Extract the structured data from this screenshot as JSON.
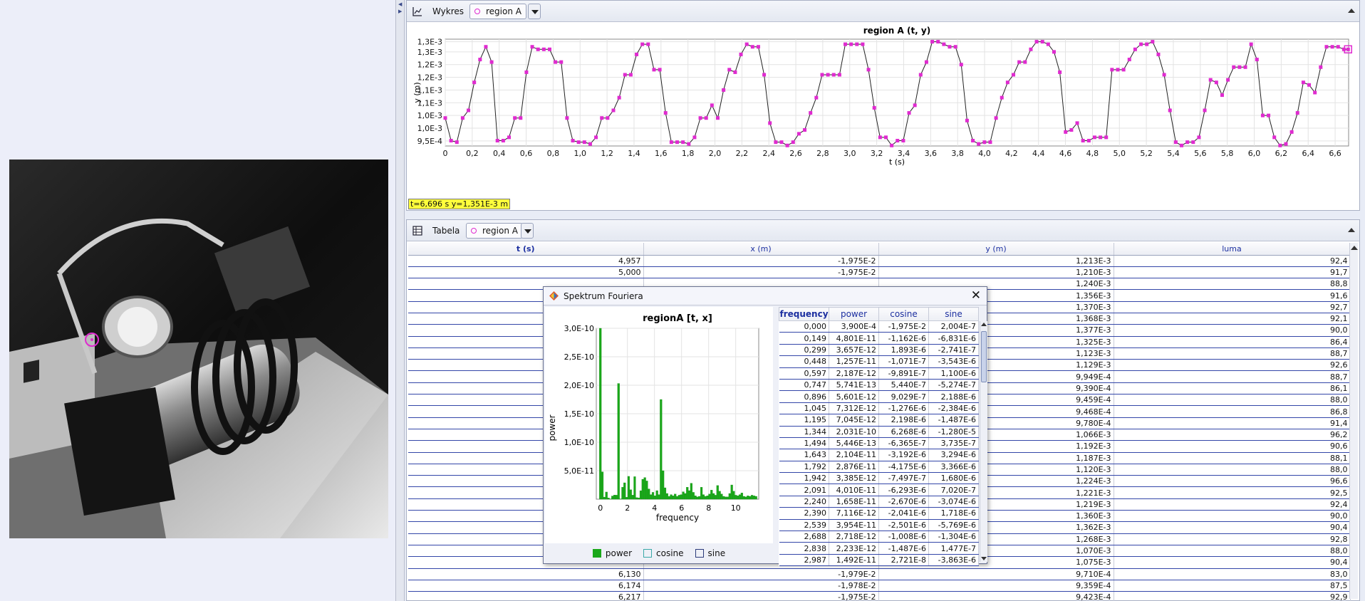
{
  "plot_panel": {
    "title": "Wykres",
    "track": "region A"
  },
  "table_panel": {
    "title": "Tabela",
    "track": "region A"
  },
  "readout": "t=6,696 s  y=1,351E-3 m",
  "chart_data": [
    {
      "type": "line",
      "title": "region A (t, y)",
      "xlabel": "t (s)",
      "ylabel": "y (m)",
      "xlim": [
        0,
        6.7
      ],
      "ylim": [
        0.00093,
        0.00135
      ],
      "x_ticks": [
        "0",
        "0,2",
        "0,4",
        "0,6",
        "0,8",
        "1,0",
        "1,2",
        "1,4",
        "1,6",
        "1,8",
        "2,0",
        "2,2",
        "2,4",
        "2,6",
        "2,8",
        "3,0",
        "3,2",
        "3,4",
        "3,6",
        "3,8",
        "4,0",
        "4,2",
        "4,4",
        "4,6",
        "4,8",
        "5,0",
        "5,2",
        "5,4",
        "5,6",
        "5,8",
        "6,0",
        "6,2",
        "6,4",
        "6,6"
      ],
      "y_ticks": [
        {
          "label": "9,5E-4",
          "value": 0.00095
        },
        {
          "label": "1,0E-3",
          "value": 0.001
        },
        {
          "label": "1,0E-3",
          "value": 0.00105
        },
        {
          "label": "1,1E-3",
          "value": 0.0011
        },
        {
          "label": "1,1E-3",
          "value": 0.00115
        },
        {
          "label": "1,2E-3",
          "value": 0.0012
        },
        {
          "label": "1,2E-3",
          "value": 0.00125
        },
        {
          "label": "1,3E-3",
          "value": 0.0013
        },
        {
          "label": "1,3E-3",
          "value": 0.00134
        }
      ],
      "grid": true,
      "series": [
        {
          "color": "#e02ad0",
          "x": [
            0,
            0.043,
            0.086,
            0.129,
            0.172,
            0.215,
            0.258,
            0.301,
            0.344,
            0.387,
            0.43,
            0.473,
            0.516,
            0.559,
            0.602,
            0.645,
            0.688,
            0.731,
            0.774,
            0.817,
            0.86,
            0.903,
            0.946,
            0.989,
            1.032,
            1.075,
            1.118,
            1.161,
            1.204,
            1.247,
            1.29,
            1.333,
            1.376,
            1.419,
            1.462,
            1.505,
            1.548,
            1.591,
            1.634,
            1.677,
            1.72,
            1.763,
            1.806,
            1.849,
            1.892,
            1.935,
            1.978,
            2.021,
            2.064,
            2.107,
            2.15,
            2.193,
            2.236,
            2.279,
            2.322,
            2.365,
            2.408,
            2.451,
            2.494,
            2.537,
            2.58,
            2.623,
            2.666,
            2.709,
            2.752,
            2.795,
            2.838,
            2.881,
            2.924,
            2.967,
            3.01,
            3.053,
            3.096,
            3.139,
            3.182,
            3.225,
            3.268,
            3.311,
            3.354,
            3.397,
            3.44,
            3.483,
            3.526,
            3.569,
            3.612,
            3.655,
            3.698,
            3.741,
            3.784,
            3.827,
            3.87,
            3.913,
            3.956,
            3.999,
            4.042,
            4.085,
            4.128,
            4.171,
            4.214,
            4.257,
            4.3,
            4.343,
            4.386,
            4.429,
            4.472,
            4.515,
            4.558,
            4.601,
            4.644,
            4.687,
            4.73,
            4.773,
            4.816,
            4.859,
            4.902,
            4.945,
            4.988,
            5.031,
            5.074,
            5.117,
            5.16,
            5.203,
            5.246,
            5.289,
            5.332,
            5.375,
            5.418,
            5.461,
            5.504,
            5.547,
            5.59,
            5.633,
            5.676,
            5.719,
            5.762,
            5.805,
            5.848,
            5.891,
            5.934,
            5.977,
            6.02,
            6.063,
            6.106,
            6.149,
            6.192,
            6.235,
            6.278,
            6.321,
            6.364,
            6.407,
            6.45,
            6.493,
            6.536,
            6.579,
            6.622,
            6.665,
            6.696
          ],
          "y": [
            0.00104,
            0.000951,
            0.000945,
            0.00104,
            0.00107,
            0.00118,
            0.00127,
            0.00132,
            0.00126,
            0.000951,
            0.000951,
            0.000964,
            0.00104,
            0.00104,
            0.00122,
            0.00132,
            0.00131,
            0.00131,
            0.00131,
            0.00126,
            0.00126,
            0.00104,
            0.000951,
            0.000945,
            0.000945,
            0.000938,
            0.000964,
            0.00104,
            0.00104,
            0.00107,
            0.00112,
            0.00121,
            0.00121,
            0.00129,
            0.00133,
            0.00133,
            0.00123,
            0.00123,
            0.00106,
            0.000945,
            0.000945,
            0.000945,
            0.000938,
            0.000964,
            0.00104,
            0.00104,
            0.00109,
            0.00104,
            0.00115,
            0.00123,
            0.00122,
            0.00129,
            0.00133,
            0.00132,
            0.00132,
            0.00121,
            0.00102,
            0.000945,
            0.000945,
            0.000932,
            0.000945,
            0.000978,
            0.000993,
            0.00106,
            0.00112,
            0.00121,
            0.00121,
            0.00121,
            0.00121,
            0.00133,
            0.00133,
            0.00133,
            0.00133,
            0.00123,
            0.00108,
            0.000964,
            0.000964,
            0.000932,
            0.000951,
            0.000951,
            0.00106,
            0.00109,
            0.00121,
            0.00126,
            0.00134,
            0.00134,
            0.00133,
            0.00132,
            0.00132,
            0.00125,
            0.00103,
            0.000951,
            0.000938,
            0.000945,
            0.000945,
            0.00104,
            0.00112,
            0.00118,
            0.00121,
            0.00126,
            0.00126,
            0.00131,
            0.00134,
            0.00134,
            0.00133,
            0.0013,
            0.00122,
            0.000985,
            0.000993,
            0.00102,
            0.000951,
            0.000951,
            0.000964,
            0.000964,
            0.000964,
            0.00123,
            0.00123,
            0.00123,
            0.00127,
            0.00131,
            0.00133,
            0.00133,
            0.00134,
            0.00129,
            0.00121,
            0.00107,
            0.000945,
            0.000932,
            0.000945,
            0.000945,
            0.000964,
            0.00107,
            0.00119,
            0.00118,
            0.00113,
            0.00119,
            0.00124,
            0.00124,
            0.00124,
            0.00133,
            0.00127,
            0.00105,
            0.00105,
            0.000964,
            0.000932,
            0.000938,
            0.000985,
            0.00106,
            0.00118,
            0.00117,
            0.00114,
            0.00124,
            0.00132,
            0.00132,
            0.00132,
            0.00131,
            0.00131
          ]
        }
      ]
    },
    {
      "type": "bar",
      "title": "regionA [t, x]",
      "xlabel": "frequency",
      "ylabel": "power",
      "xlim": [
        -0.3,
        11.7
      ],
      "ylim": [
        0,
        3e-10
      ],
      "x_ticks": [
        "0",
        "2",
        "4",
        "6",
        "8",
        "10"
      ],
      "y_ticks": [
        "5,0E-11",
        "1,0E-10",
        "1,5E-10",
        "2,0E-10",
        "2,5E-10",
        "3,0E-10"
      ],
      "legend_position": "bottom",
      "series": [
        {
          "name": "power",
          "color": "#1aa81a",
          "x": [
            0,
            0.149,
            0.299,
            0.448,
            0.597,
            0.747,
            0.896,
            1.045,
            1.195,
            1.344,
            1.494,
            1.643,
            1.792,
            1.942,
            2.091,
            2.24,
            2.39,
            2.539,
            2.688,
            2.838,
            2.987,
            3.136,
            3.286,
            3.435,
            3.584,
            3.734,
            3.883,
            4.032,
            4.182,
            4.331,
            4.48,
            4.63,
            4.779,
            4.928,
            5.078,
            5.227,
            5.376,
            5.526,
            5.675,
            5.824,
            5.974,
            6.123,
            6.272,
            6.422,
            6.571,
            6.72,
            6.87,
            7.019,
            7.168,
            7.318,
            7.467,
            7.616,
            7.766,
            7.915,
            8.064,
            8.214,
            8.363,
            8.512,
            8.662,
            8.811,
            8.96,
            9.11,
            9.259,
            9.408,
            9.558,
            9.707,
            9.856,
            10.006,
            10.155,
            10.304,
            10.454,
            10.603,
            10.752,
            10.902,
            11.051,
            11.2,
            11.35,
            11.499
          ],
          "values": [
            3e-10,
            4.801e-11,
            3.657e-12,
            1.257e-11,
            2.187e-12,
            5.741e-13,
            5.601e-12,
            7.312e-12,
            7.045e-12,
            2.031e-10,
            5.446e-13,
            2.104e-11,
            2.876e-11,
            3.385e-12,
            4.01e-11,
            1.658e-11,
            7.116e-12,
            3.954e-11,
            2.718e-12,
            2.233e-12,
            1.492e-11,
            3.5e-11,
            3.8e-11,
            3.2e-11,
            1.8e-11,
            8e-12,
            1.2e-11,
            6e-12,
            1.5e-11,
            8e-12,
            1.75e-10,
            5e-11,
            2e-11,
            1e-11,
            5e-12,
            8e-12,
            6e-12,
            9e-12,
            5e-12,
            7e-12,
            8e-12,
            1.3e-11,
            1e-11,
            2.1e-11,
            1.5e-11,
            2.8e-11,
            1.2e-11,
            6e-12,
            4e-12,
            5e-12,
            2.1e-11,
            8e-12,
            5e-12,
            6e-12,
            9e-12,
            1.6e-11,
            1e-11,
            7e-12,
            2.4e-11,
            1.4e-11,
            9e-12,
            5e-12,
            4e-12,
            4e-12,
            1e-11,
            2.5e-11,
            1.4e-11,
            7e-12,
            6e-12,
            8e-12,
            1.1e-11,
            5e-12,
            4e-12,
            6e-12,
            5e-12,
            7e-12,
            6e-12,
            5e-12
          ]
        }
      ]
    }
  ],
  "data_table": {
    "headers": [
      "t (s)",
      "x (m)",
      "y (m)",
      "luma"
    ],
    "rows": [
      [
        "4,957",
        "-1,975E-2",
        "1,213E-3",
        "92,4"
      ],
      [
        "5,000",
        "-1,975E-2",
        "1,210E-3",
        "91,7"
      ],
      [
        "",
        "",
        "1,240E-3",
        "88,8"
      ],
      [
        "",
        "",
        "1,356E-3",
        "91,6"
      ],
      [
        "",
        "",
        "1,370E-3",
        "92,7"
      ],
      [
        "",
        "",
        "1,368E-3",
        "92,1"
      ],
      [
        "",
        "",
        "1,377E-3",
        "90,0"
      ],
      [
        "",
        "",
        "1,325E-3",
        "86,4"
      ],
      [
        "",
        "",
        "1,123E-3",
        "88,7"
      ],
      [
        "",
        "",
        "1,129E-3",
        "92,6"
      ],
      [
        "",
        "",
        "9,949E-4",
        "88,7"
      ],
      [
        "",
        "",
        "9,390E-4",
        "86,1"
      ],
      [
        "",
        "",
        "9,459E-4",
        "88,0"
      ],
      [
        "",
        "",
        "9,468E-4",
        "86,8"
      ],
      [
        "",
        "",
        "9,780E-4",
        "91,4"
      ],
      [
        "",
        "",
        "1,066E-3",
        "96,2"
      ],
      [
        "",
        "",
        "1,192E-3",
        "90,6"
      ],
      [
        "",
        "",
        "1,187E-3",
        "88,1"
      ],
      [
        "",
        "",
        "1,120E-3",
        "88,0"
      ],
      [
        "",
        "",
        "1,224E-3",
        "96,6"
      ],
      [
        "",
        "",
        "1,221E-3",
        "92,5"
      ],
      [
        "",
        "",
        "1,219E-3",
        "92,4"
      ],
      [
        "",
        "",
        "1,360E-3",
        "90,0"
      ],
      [
        "",
        "",
        "1,362E-3",
        "90,4"
      ],
      [
        "",
        "",
        "1,268E-3",
        "92,8"
      ],
      [
        "",
        "",
        "1,070E-3",
        "88,0"
      ],
      [
        "",
        "",
        "1,075E-3",
        "90,4"
      ],
      [
        "6,130",
        "-1,979E-2",
        "9,710E-4",
        "83,0"
      ],
      [
        "6,174",
        "-1,978E-2",
        "9,359E-4",
        "87,5"
      ],
      [
        "6,217",
        "-1,975E-2",
        "9,423E-4",
        "92,9"
      ]
    ]
  },
  "fourier_dialog": {
    "title": "Spektrum Fouriera",
    "legend": [
      "power",
      "cosine",
      "sine"
    ],
    "legend_colors": {
      "power": "#1aa81a",
      "cosine": "#3aa8a8",
      "sine": "#2b3a7a"
    },
    "table": {
      "headers": [
        "frequency",
        "power",
        "cosine",
        "sine"
      ],
      "rows": [
        [
          "0,000",
          "3,900E-4",
          "-1,975E-2",
          "2,004E-7"
        ],
        [
          "0,149",
          "4,801E-11",
          "-1,162E-6",
          "-6,831E-6"
        ],
        [
          "0,299",
          "3,657E-12",
          "1,893E-6",
          "-2,741E-7"
        ],
        [
          "0,448",
          "1,257E-11",
          "-1,071E-7",
          "-3,543E-6"
        ],
        [
          "0,597",
          "2,187E-12",
          "-9,891E-7",
          "1,100E-6"
        ],
        [
          "0,747",
          "5,741E-13",
          "5,440E-7",
          "-5,274E-7"
        ],
        [
          "0,896",
          "5,601E-12",
          "9,029E-7",
          "2,188E-6"
        ],
        [
          "1,045",
          "7,312E-12",
          "-1,276E-6",
          "-2,384E-6"
        ],
        [
          "1,195",
          "7,045E-12",
          "2,198E-6",
          "-1,487E-6"
        ],
        [
          "1,344",
          "2,031E-10",
          "6,268E-6",
          "-1,280E-5"
        ],
        [
          "1,494",
          "5,446E-13",
          "-6,365E-7",
          "3,735E-7"
        ],
        [
          "1,643",
          "2,104E-11",
          "-3,192E-6",
          "3,294E-6"
        ],
        [
          "1,792",
          "2,876E-11",
          "-4,175E-6",
          "3,366E-6"
        ],
        [
          "1,942",
          "3,385E-12",
          "-7,497E-7",
          "1,680E-6"
        ],
        [
          "2,091",
          "4,010E-11",
          "-6,293E-6",
          "7,020E-7"
        ],
        [
          "2,240",
          "1,658E-11",
          "-2,670E-6",
          "-3,074E-6"
        ],
        [
          "2,390",
          "7,116E-12",
          "-2,041E-6",
          "1,718E-6"
        ],
        [
          "2,539",
          "3,954E-11",
          "-2,501E-6",
          "-5,769E-6"
        ],
        [
          "2,688",
          "2,718E-12",
          "-1,008E-6",
          "-1,304E-6"
        ],
        [
          "2,838",
          "2,233E-12",
          "-1,487E-6",
          "1,477E-7"
        ],
        [
          "2,987",
          "1,492E-11",
          "2,721E-8",
          "-3,863E-6"
        ]
      ]
    }
  }
}
